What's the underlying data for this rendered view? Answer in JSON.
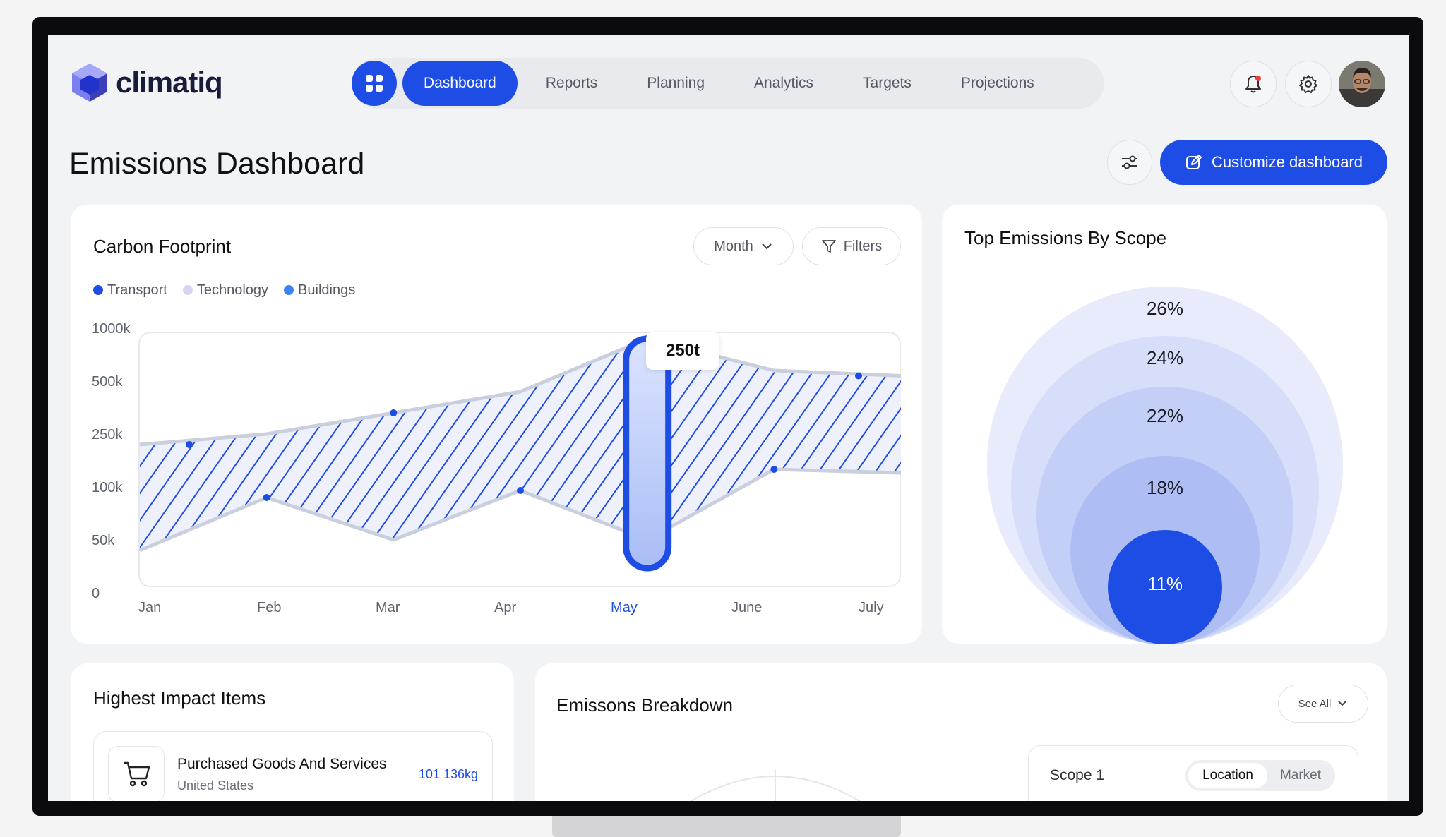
{
  "app": {
    "logo_text": "climatiq",
    "brand_color": "#1e4de6"
  },
  "nav": {
    "items": [
      {
        "label": "Dashboard",
        "active": true
      },
      {
        "label": "Reports"
      },
      {
        "label": "Planning"
      },
      {
        "label": "Analytics"
      },
      {
        "label": "Targets"
      },
      {
        "label": "Projections"
      }
    ],
    "icons": [
      "grid-icon",
      "bell-icon",
      "gear-icon"
    ]
  },
  "page": {
    "title": "Emissions Dashboard",
    "customize_label": "Customize dashboard"
  },
  "carbon": {
    "title": "Carbon Footprint",
    "period_label": "Month",
    "filters_label": "Filters",
    "legend": [
      {
        "label": "Transport",
        "color": "#1e4de6"
      },
      {
        "label": "Technology",
        "color": "#d6d3f5"
      },
      {
        "label": "Buildings",
        "color": "#3b82f6"
      }
    ],
    "tooltip": "250t"
  },
  "chart_data": {
    "type": "area",
    "categories": [
      "Jan",
      "Feb",
      "Mar",
      "Apr",
      "May",
      "June",
      "July"
    ],
    "y_ticks": [
      "1000k",
      "500k",
      "250k",
      "100k",
      "50k",
      "0"
    ],
    "highlight": {
      "category": "May",
      "label": "250t"
    },
    "series": [
      {
        "name": "upper",
        "values": [
          250,
          300,
          400,
          500,
          1000,
          700,
          650
        ]
      },
      {
        "name": "lower",
        "values": [
          50,
          100,
          60,
          120,
          60,
          180,
          170
        ]
      }
    ]
  },
  "scope": {
    "title": "Top Emissions By Scope",
    "values": [
      "26%",
      "24%",
      "22%",
      "18%",
      "11%"
    ]
  },
  "impact": {
    "title": "Highest Impact Items",
    "item": {
      "name": "Purchased Goods And Services",
      "country": "United States",
      "value": "101 136kg"
    }
  },
  "breakdown": {
    "title": "Emissons Breakdown",
    "see_all": "See All",
    "scope_label": "Scope 1",
    "seg_on": "Location",
    "seg_off": "Market"
  }
}
